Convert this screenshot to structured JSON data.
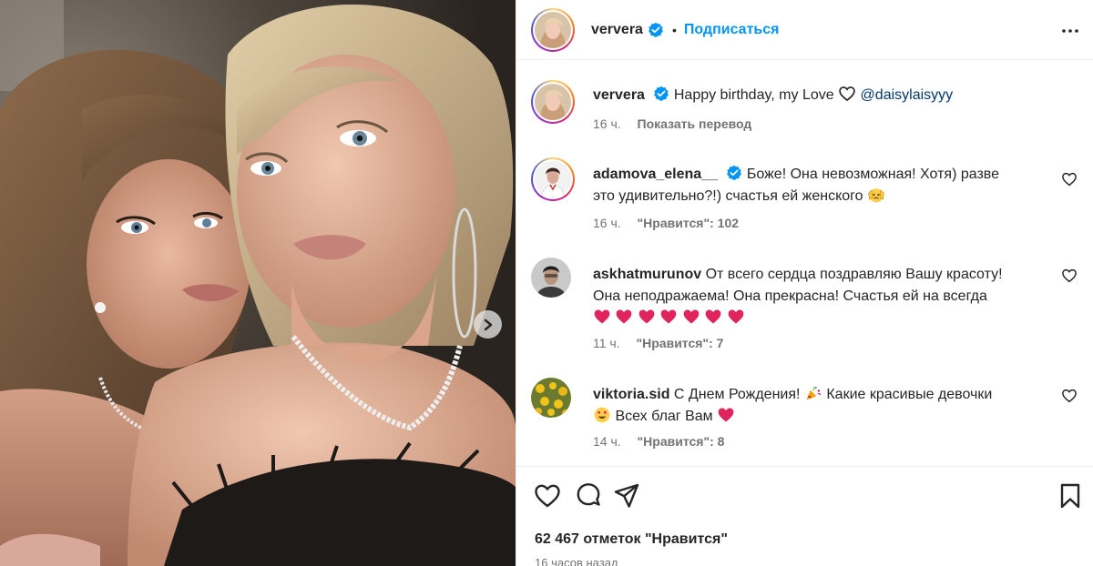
{
  "post": {
    "author": "ververa",
    "follow_label": "Подписаться",
    "dot": "•"
  },
  "caption": {
    "username": "ververa",
    "text": "Happy birthday, my Love ",
    "mention": "@daisylaisyyy",
    "time": "16 ч.",
    "translate_label": "Показать перевод"
  },
  "comments": [
    {
      "username": "adamova_elena__",
      "verified": true,
      "text_line1": " Боже! Она невозможная! Хотя) разве",
      "text_line2": "это удивительно?!) счастья ей женского",
      "time": "16 ч.",
      "likes": "\"Нравится\": 102"
    },
    {
      "username": "askhatmurunov",
      "verified": false,
      "text_line1": " От всего сердца поздравляю Вашу красоту!",
      "text_line2": "Она неподражаема! Она прекрасна! Счастья ей на всегда",
      "time": "11 ч.",
      "likes": "\"Нравится\": 7"
    },
    {
      "username": "viktoria.sid",
      "verified": false,
      "text_line1a": " С Днем Рождения! ",
      "text_line1b": " Какие красивые девочки",
      "text_line2": " Всех благ Вам",
      "time": "14 ч.",
      "likes": "\"Нравится\": 8"
    }
  ],
  "footer": {
    "likes_total": "62 467 отметок \"Нравится\"",
    "time_ago": "16 часов назад"
  },
  "colors": {
    "accent": "#0095f6",
    "verified": "#0095f6",
    "heart_emoji": "#e0245e"
  }
}
